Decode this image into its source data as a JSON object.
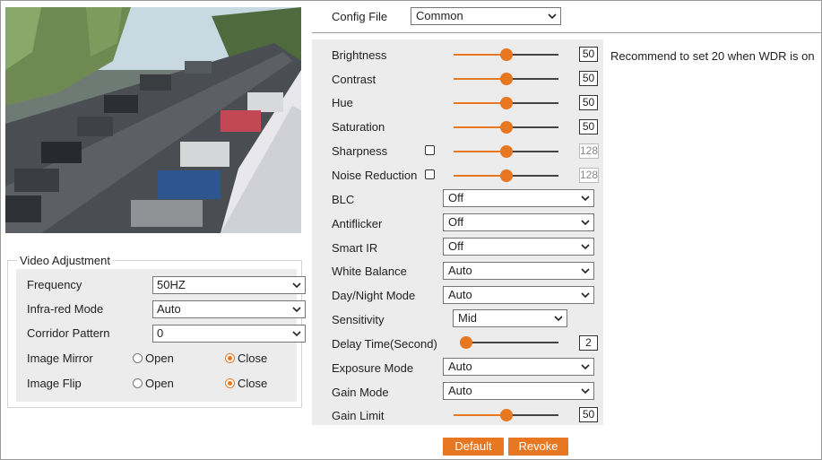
{
  "config": {
    "label": "Config File",
    "value": "Common"
  },
  "video_adjustment": {
    "title": "Video Adjustment",
    "frequency": {
      "label": "Frequency",
      "value": "50HZ"
    },
    "infrared": {
      "label": "Infra-red Mode",
      "value": "Auto"
    },
    "corridor": {
      "label": "Corridor Pattern",
      "value": "0"
    },
    "mirror": {
      "label": "Image Mirror",
      "open": "Open",
      "close": "Close",
      "selected": "Close"
    },
    "flip": {
      "label": "Image Flip",
      "open": "Open",
      "close": "Close",
      "selected": "Close"
    }
  },
  "image": {
    "brightness": {
      "label": "Brightness",
      "value": "50",
      "level": 0.5
    },
    "contrast": {
      "label": "Contrast",
      "value": "50",
      "level": 0.5
    },
    "hue": {
      "label": "Hue",
      "value": "50",
      "level": 0.5
    },
    "saturation": {
      "label": "Saturation",
      "value": "50",
      "level": 0.5
    },
    "sharpness": {
      "label": "Sharpness",
      "value": "128",
      "level": 0.5,
      "checked": false
    },
    "noise_reduction": {
      "label": "Noise Reduction",
      "value": "128",
      "level": 0.5,
      "checked": false
    },
    "recommend_note": "Recommend to set 20 when WDR is on",
    "blc": {
      "label": "BLC",
      "value": "Off"
    },
    "antiflicker": {
      "label": "Antiflicker",
      "value": "Off"
    },
    "smart_ir": {
      "label": "Smart IR",
      "value": "Off"
    },
    "white_balance": {
      "label": "White Balance",
      "value": "Auto"
    },
    "day_night": {
      "label": "Day/Night Mode",
      "value": "Auto"
    },
    "sensitivity": {
      "label": "Sensitivity",
      "value": "Mid"
    },
    "delay_time": {
      "label": "Delay Time(Second)",
      "value": "2",
      "level": 0.0
    },
    "exposure_mode": {
      "label": "Exposure Mode",
      "value": "Auto"
    },
    "gain_mode": {
      "label": "Gain Mode",
      "value": "Auto"
    },
    "gain_limit": {
      "label": "Gain Limit",
      "value": "50",
      "level": 0.5
    }
  },
  "buttons": {
    "default": "Default",
    "revoke": "Revoke"
  },
  "colors": {
    "accent": "#e87722",
    "panel": "#ececec"
  }
}
